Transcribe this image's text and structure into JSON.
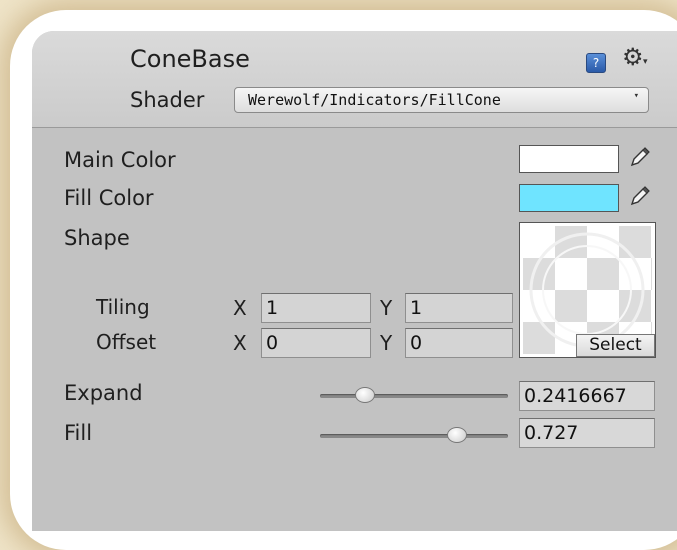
{
  "material": {
    "name": "ConeBase",
    "help_icon_glyph": "?",
    "settings_icon": "gear-icon",
    "settings_caret": "▾"
  },
  "shader": {
    "label": "Shader",
    "value": "Werewolf/Indicators/FillCone",
    "arrow": "▾"
  },
  "properties": {
    "main_color": {
      "label": "Main Color",
      "color": "#ffffff"
    },
    "fill_color": {
      "label": "Fill Color",
      "color": "#6fe4ff"
    },
    "shape": {
      "label": "Shape",
      "tiling": {
        "label": "Tiling",
        "x_label": "X",
        "x": "1",
        "y_label": "Y",
        "y": "1"
      },
      "offset": {
        "label": "Offset",
        "x_label": "X",
        "x": "0",
        "y_label": "Y",
        "y": "0"
      },
      "select_label": "Select"
    },
    "expand": {
      "label": "Expand",
      "value": "0.2416667",
      "slider_fraction": 0.24
    },
    "fill": {
      "label": "Fill",
      "value": "0.727",
      "slider_fraction": 0.727
    }
  }
}
